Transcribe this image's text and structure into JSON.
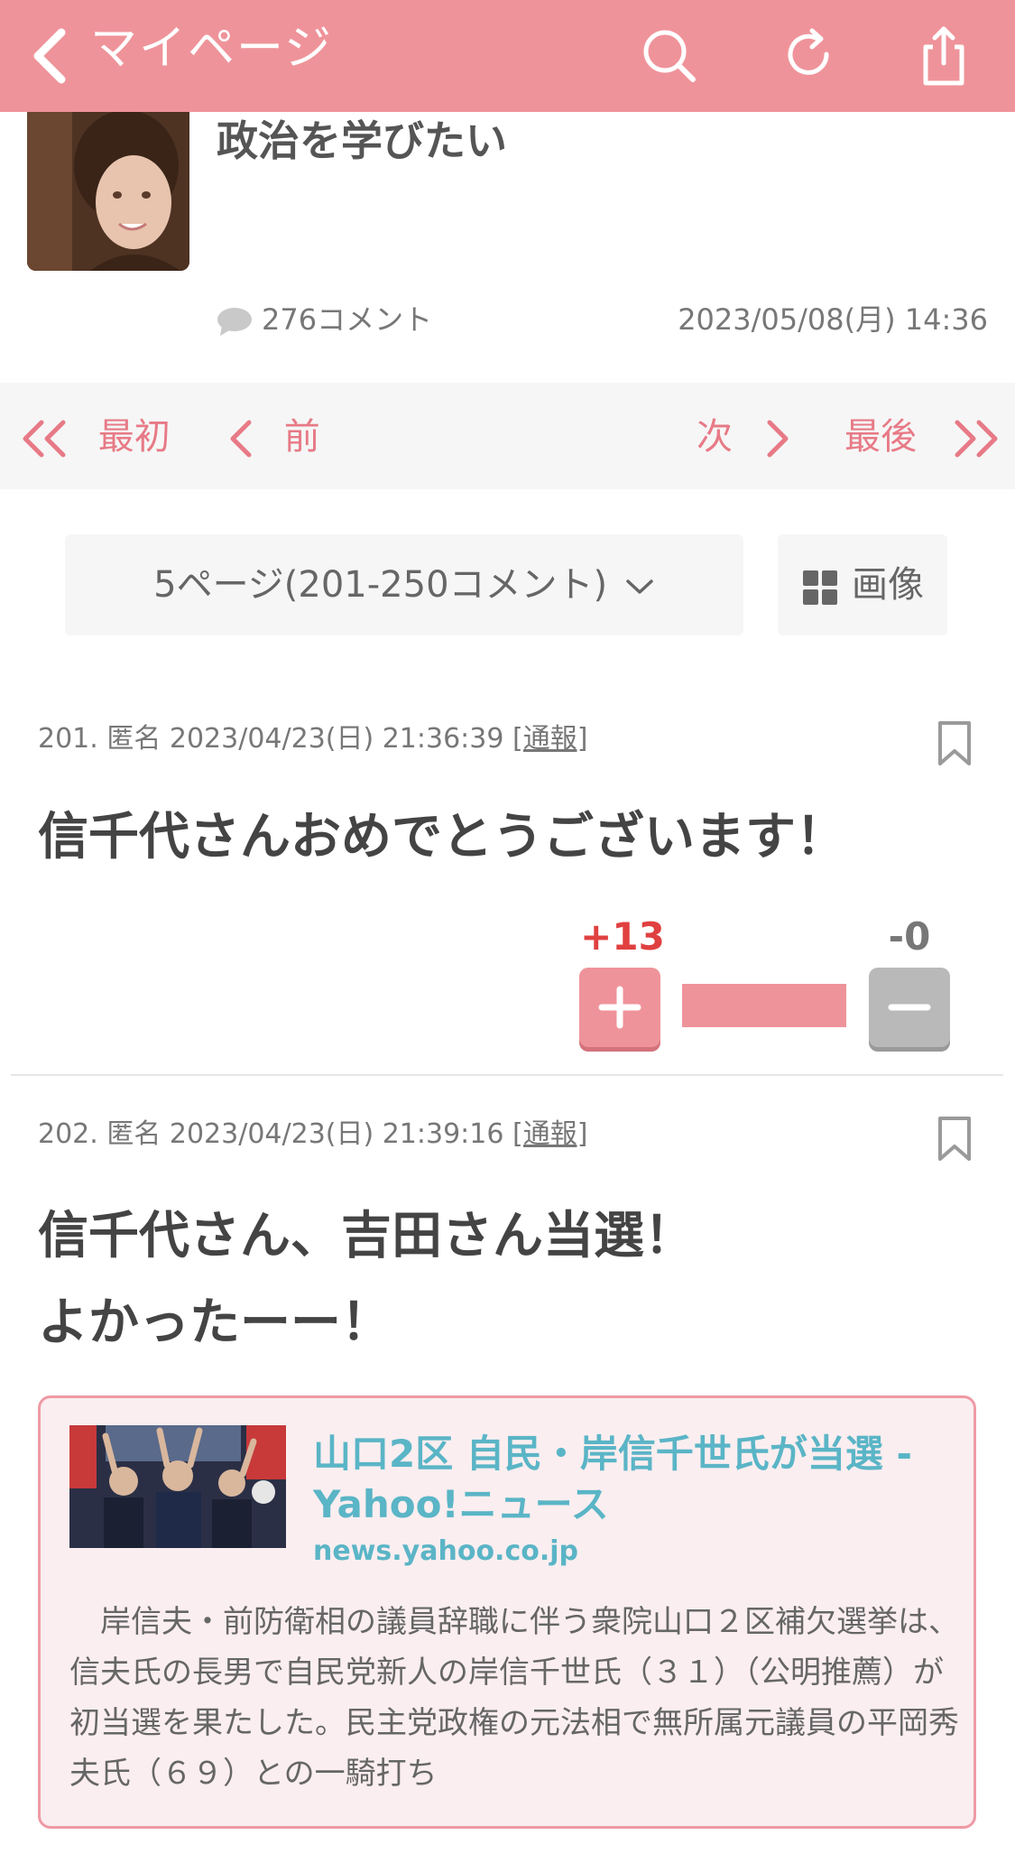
{
  "header": {
    "title": "マイページ"
  },
  "topic": {
    "title": "政治を学びたい",
    "comment_count": "276コメント",
    "date": "2023/05/08(月) 14:36"
  },
  "pager": {
    "first": "最初",
    "prev": "前",
    "next": "次",
    "last": "最後"
  },
  "page_select": {
    "label": "5ページ(201-250コメント)"
  },
  "image_button": {
    "label": "画像"
  },
  "comments": [
    {
      "meta": "201. 匿名 2023/04/23(日) 21:36:39",
      "report": "[通報]",
      "body": "信千代さんおめでとうございます！",
      "plus_label": "+13",
      "minus_label": "-0",
      "plus_ratio": 1.0
    },
    {
      "meta": "202. 匿名 2023/04/23(日) 21:39:16",
      "report": "[通報]",
      "body_line1": "信千代さん、吉田さん当選！",
      "body_line2": "よかったーー！",
      "link": {
        "title": "山口2区 自民・岸信千世氏が当選 - Yahoo!ニュース",
        "domain": "news.yahoo.co.jp",
        "description": "岸信夫・前防衛相の議員辞職に伴う衆院山口２区補欠選挙は、信夫氏の長男で自民党新人の岸信千世氏（３１）（公明推薦）が初当選を果たした。民主党政権の元法相で無所属元議員の平岡秀夫氏（６９）との一騎打ち"
      }
    }
  ],
  "colors": {
    "header_bg": "#ef939a",
    "pager_text": "#e77a86",
    "plus_num": "#e04040",
    "link_text": "#5ab5c6",
    "card_bg": "#fbeef0"
  }
}
